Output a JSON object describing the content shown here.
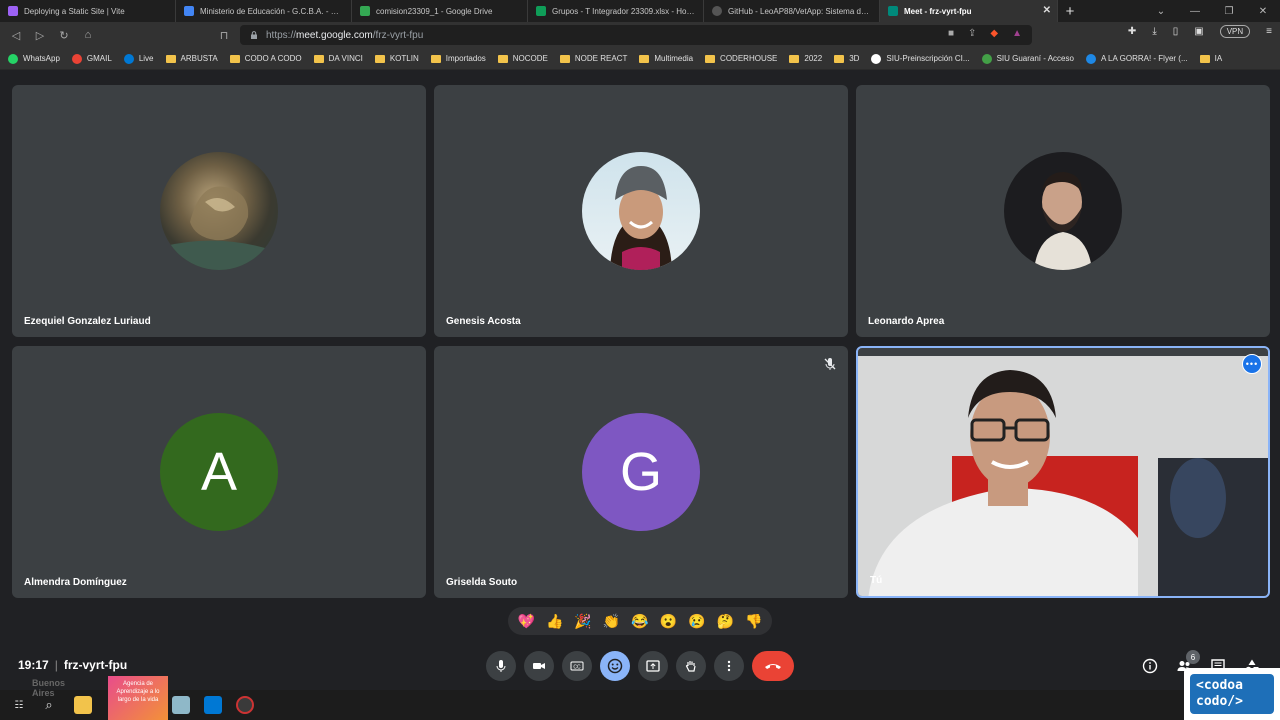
{
  "browser": {
    "tabs": [
      {
        "label": "Deploying a Static Site | Vite",
        "color": "#9d62f5"
      },
      {
        "label": "Ministerio de Educación - G.C.B.A. - Calen",
        "color": "#4285f4"
      },
      {
        "label": "comision23309_1 - Google Drive",
        "color": "#34a853"
      },
      {
        "label": "Grupos - T Integrador 23309.xlsx - Hojas",
        "color": "#0f9d58"
      },
      {
        "label": "GitHub - LeoAP88/VetApp: Sistema de co",
        "color": "#333333"
      },
      {
        "label": "Meet - frz-vyrt-fpu",
        "color": "#00897b",
        "active": true
      }
    ],
    "url_scheme": "https://",
    "url_host": "meet.google.com",
    "url_path": "/frz-vyrt-fpu",
    "vpn_label": "VPN",
    "bookmarks": [
      {
        "label": "WhatsApp",
        "icon": "whatsapp-icon",
        "color": "#25d366"
      },
      {
        "label": "GMAIL",
        "icon": "gmail-icon",
        "color": "#ea4335"
      },
      {
        "label": "Live",
        "icon": "outlook-icon",
        "color": "#0078d4"
      },
      {
        "label": "ARBUSTA",
        "icon": "folder-icon"
      },
      {
        "label": "CODO A CODO",
        "icon": "folder-icon"
      },
      {
        "label": "DA VINCI",
        "icon": "folder-icon"
      },
      {
        "label": "KOTLIN",
        "icon": "folder-icon"
      },
      {
        "label": "Importados",
        "icon": "folder-icon"
      },
      {
        "label": "NOCODE",
        "icon": "folder-icon"
      },
      {
        "label": "NODE REACT",
        "icon": "folder-icon"
      },
      {
        "label": "Multimedia",
        "icon": "folder-icon"
      },
      {
        "label": "CODERHOUSE",
        "icon": "folder-icon"
      },
      {
        "label": "2022",
        "icon": "folder-icon"
      },
      {
        "label": "3D",
        "icon": "folder-icon"
      },
      {
        "label": "SIU-Preinscripción CI...",
        "icon": "siu-icon",
        "color": "#ffffff"
      },
      {
        "label": "SIU Guaraní - Acceso",
        "icon": "siu-guarani-icon",
        "color": "#43a047"
      },
      {
        "label": "A LA GORRA! - Flyer (...",
        "icon": "edge-icon",
        "color": "#1e88e5"
      },
      {
        "label": "IA",
        "icon": "folder-icon"
      }
    ]
  },
  "meet": {
    "participants": [
      {
        "name": "Ezequiel Gonzalez Luriaud",
        "avatar": "dragon-photo"
      },
      {
        "name": "Genesis Acosta",
        "avatar": "woman-beanie-photo"
      },
      {
        "name": "Leonardo Aprea",
        "avatar": "man-beard-photo"
      },
      {
        "name": "Almendra Domínguez",
        "letter": "A",
        "color": "#33691e"
      },
      {
        "name": "Griselda Souto",
        "letter": "G",
        "color": "#7e57c2",
        "muted": true
      },
      {
        "name": "Tú",
        "self": true
      }
    ],
    "reactions": [
      "💖",
      "👍",
      "🎉",
      "👏",
      "😂",
      "😮",
      "😢",
      "🤔",
      "👎"
    ],
    "time": "19:17",
    "meeting_code": "frz-vyrt-fpu",
    "people_count": "6"
  },
  "taskbar": {
    "weather": "Buenos",
    "weather2": "Aires",
    "agencia": "Agencia de Aprendizaje a lo largo de la vida"
  },
  "logo": {
    "line1": "<codoa",
    "line2": "codo/>"
  }
}
